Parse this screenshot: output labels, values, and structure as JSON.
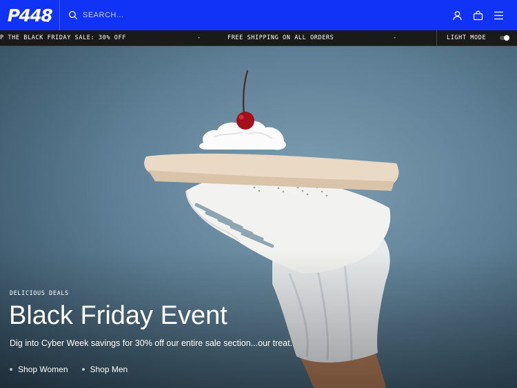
{
  "brand": {
    "logo_text": "P448"
  },
  "search": {
    "placeholder": "SEARCH..."
  },
  "header": {
    "icons": [
      "account-icon",
      "bag-icon",
      "menu-icon"
    ]
  },
  "ticker": {
    "items": [
      "P THE BLACK FRIDAY SALE: 30% OFF",
      "-",
      "FREE SHIPPING ON ALL ORDERS",
      "-"
    ],
    "mode_label": "LIGHT MODE"
  },
  "hero": {
    "eyebrow": "DELICIOUS DEALS",
    "title": "Black Friday Event",
    "description": "Dig into Cyber Week savings for 30% off our entire sale section...our treat.",
    "links": [
      {
        "label": "Shop Women"
      },
      {
        "label": "Shop Men"
      }
    ]
  },
  "colors": {
    "header_bg": "#1033f5",
    "ticker_bg": "#1a1a1a",
    "hero_bg": "#5e7f95"
  }
}
